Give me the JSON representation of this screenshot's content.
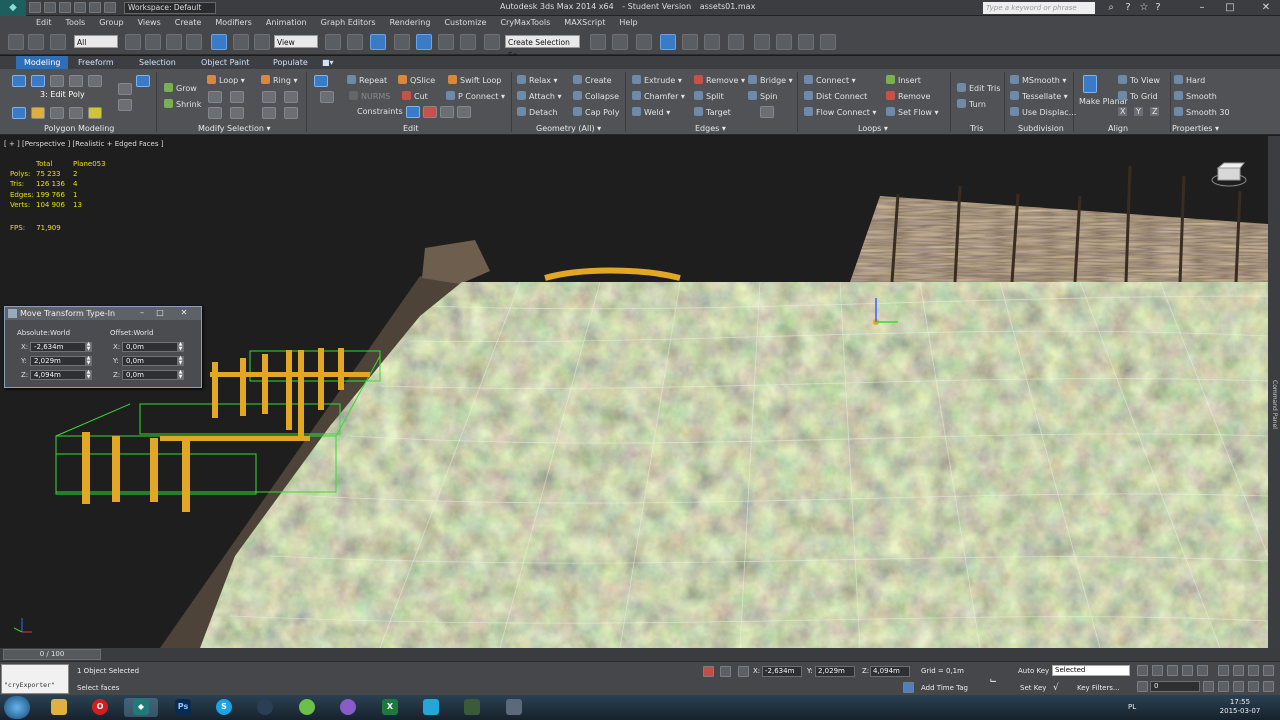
{
  "titlebar": {
    "workspace": "Workspace: Default",
    "app_name": "Autodesk 3ds Max  2014 x64",
    "edition": "- Student Version",
    "file": "assets01.max",
    "search_placeholder": "Type a keyword or phrase"
  },
  "menus": [
    "Edit",
    "Tools",
    "Group",
    "Views",
    "Create",
    "Modifiers",
    "Animation",
    "Graph Editors",
    "Rendering",
    "Customize",
    "CryMaxTools",
    "MAXScript",
    "Help"
  ],
  "toolbar": {
    "selection_filter": "All",
    "ref_coord": "View",
    "named_selection_placeholder": "Create Selection Se"
  },
  "ribbon": {
    "tabs": [
      "Modeling",
      "Freeform",
      "Selection",
      "Object Paint",
      "Populate"
    ],
    "edit_poly_label": "3: Edit Poly",
    "panels": [
      "Polygon Modeling",
      "Modify Selection",
      "Edit",
      "Geometry (All)",
      "Edges",
      "Loops",
      "Tris",
      "Subdivision",
      "Align",
      "Properties"
    ],
    "modify_selection": [
      "Grow",
      "Shrink",
      "Loop",
      "Ring"
    ],
    "edit": [
      "Repeat",
      "QSlice",
      "Swift Loop",
      "NURMS",
      "Cut",
      "P Connect",
      "Constraints"
    ],
    "geometry": [
      "Relax",
      "Create",
      "Attach",
      "Collapse",
      "Detach",
      "Cap Poly"
    ],
    "edges": [
      "Extrude",
      "Remove",
      "Bridge",
      "Chamfer",
      "Split",
      "Spin",
      "Weld",
      "Target"
    ],
    "loops": [
      "Connect",
      "Dist Connect",
      "Flow Connect",
      "Insert",
      "Remove",
      "Set Flow"
    ],
    "tris": [
      "Edit Tris",
      "Turn"
    ],
    "subdivision": [
      "MSmooth",
      "Tessellate",
      "Use Displac..."
    ],
    "align": [
      "Make Planar",
      "To View",
      "To Grid",
      "X",
      "Y",
      "Z"
    ],
    "properties": [
      "Hard",
      "Smooth",
      "Smooth 30"
    ]
  },
  "viewport": {
    "label": "[ + ] [Perspective ] [Realistic + Edged Faces ]",
    "stats_header": [
      "",
      "Total",
      "Plane053"
    ],
    "stats": [
      [
        "Polys:",
        "75 233",
        "2"
      ],
      [
        "Tris:",
        "126 136",
        "4"
      ],
      [
        "Edges:",
        "199 766",
        "1"
      ],
      [
        "Verts:",
        "104 906",
        "13"
      ]
    ],
    "fps_label": "FPS:",
    "fps_value": "71,909",
    "command_panel": "Command Panel"
  },
  "transform_dialog": {
    "title": "Move Transform Type-In",
    "absolute_title": "Absolute:World",
    "offset_title": "Offset:World",
    "absolute": {
      "x": "-2,634m",
      "y": "2,029m",
      "z": "4,094m"
    },
    "offset": {
      "x": "0,0m",
      "y": "0,0m",
      "z": "0,0m"
    },
    "axes": [
      "X:",
      "Y:",
      "Z:"
    ]
  },
  "status": {
    "time_slider": "0 / 100",
    "maxscript_text": "\"cryExporter\"",
    "objects_selected": "1 Object Selected",
    "prompt": "Select faces",
    "x_label": "X:",
    "x_value": "-2,634m",
    "y_label": "Y:",
    "y_value": "2,029m",
    "z_label": "Z:",
    "z_value": "4,094m",
    "grid": "Grid = 0,1m",
    "add_time_tag": "Add Time Tag",
    "auto_key": "Auto Key",
    "selected_option": "Selected",
    "set_key": "Set Key",
    "key_filters": "Key Filters...",
    "frame": "0"
  },
  "taskbar": {
    "language": "PL",
    "time": "17:55",
    "date": "2015-03-07"
  }
}
